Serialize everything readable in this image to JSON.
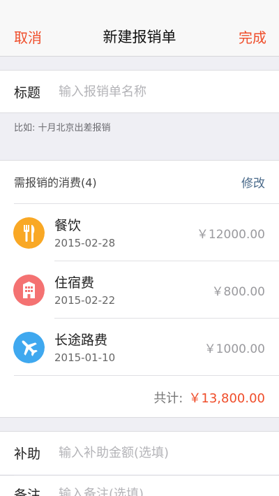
{
  "nav": {
    "cancel": "取消",
    "title": "新建报销单",
    "done": "完成"
  },
  "title_row": {
    "label": "标题",
    "placeholder": "输入报销单名称"
  },
  "hint": "比如: 十月北京出差报销",
  "expenses": {
    "header": "需报销的消费(4)",
    "edit": "修改",
    "items": [
      {
        "name": "餐饮",
        "date": "2015-02-28",
        "amount": "￥12000.00",
        "icon": "fork-knife-icon",
        "color": "#f9a825"
      },
      {
        "name": "住宿费",
        "date": "2015-02-22",
        "amount": "￥800.00",
        "icon": "hotel-icon",
        "color": "#f47272"
      },
      {
        "name": "长途路费",
        "date": "2015-01-10",
        "amount": "￥1000.00",
        "icon": "airplane-icon",
        "color": "#3fa8ef"
      }
    ],
    "total_label": "共计:",
    "total_value": "￥13,800.00"
  },
  "subsidy": {
    "label": "补助",
    "placeholder": "输入补助金额(选填)"
  },
  "note": {
    "label": "备注",
    "placeholder": "输入备注(选填)"
  },
  "colors": {
    "accent": "#ef4d2a",
    "link": "#4a6a8a"
  }
}
